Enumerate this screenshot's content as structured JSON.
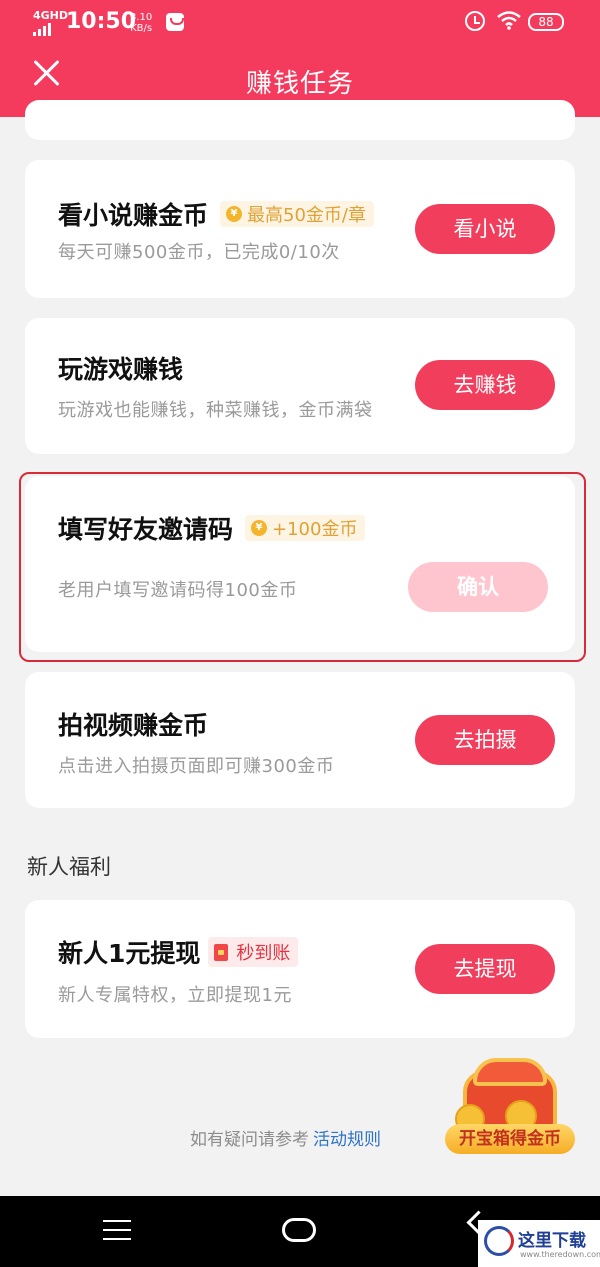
{
  "status_bar": {
    "network": "4GHD",
    "time": "10:50",
    "speed_value": "3.10",
    "speed_unit": "KB/s",
    "battery": "88"
  },
  "header": {
    "title": "赚钱任务"
  },
  "tasks": [
    {
      "title": "看小说赚金币",
      "reward": "最高50金币/章",
      "subtitle": "每天可赚500金币，已完成0/10次",
      "button": "看小说"
    },
    {
      "title": "玩游戏赚钱",
      "subtitle": "玩游戏也能赚钱，种菜赚钱，金币满袋",
      "button": "去赚钱"
    },
    {
      "title": "填写好友邀请码",
      "reward": "+100金币",
      "subtitle": "老用户填写邀请码得100金币",
      "button": "确认"
    },
    {
      "title": "拍视频赚金币",
      "subtitle": "点击进入拍摄页面即可赚300金币",
      "button": "去拍摄"
    }
  ],
  "newbie_section": {
    "label": "新人福利",
    "title": "新人1元提现",
    "badge": "秒到账",
    "subtitle": "新人专属特权，立即提现1元",
    "button": "去提现"
  },
  "footer": {
    "note": "如有疑问请参考",
    "link": "活动规则"
  },
  "treasure": {
    "label": "开宝箱得金币"
  },
  "watermark": {
    "text": "这里下载",
    "url": "www.theredown.com"
  },
  "colors": {
    "brand": "#f53b5d",
    "button": "#f13e5c",
    "button_disabled": "#fec5cf",
    "reward_text": "#e0a234",
    "link": "#2f73c8"
  }
}
